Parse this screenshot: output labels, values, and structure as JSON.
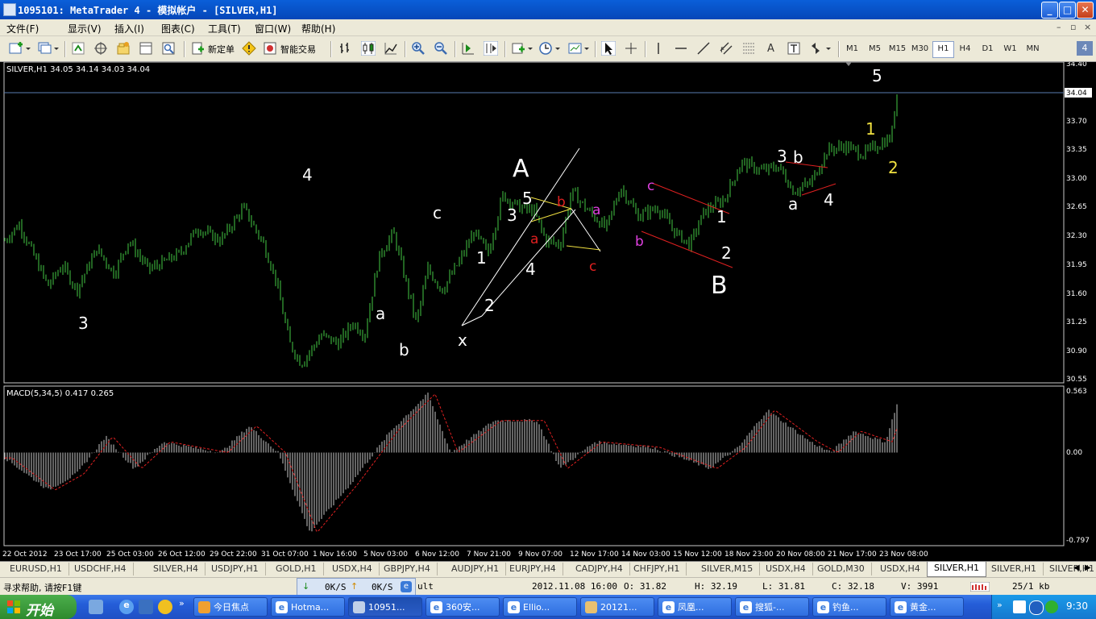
{
  "window": {
    "title": "1095101: MetaTrader 4 - 模拟帐户 - [SILVER,H1]",
    "min": "_",
    "max": "□",
    "close": "✕"
  },
  "menu": {
    "items": [
      "文件(F)",
      "显示(V)",
      "插入(I)",
      "图表(C)",
      "工具(T)",
      "窗口(W)",
      "帮助(H)"
    ],
    "mdi_controls": [
      "–",
      "▫",
      "×"
    ]
  },
  "toolbar": {
    "new_order": "新定单",
    "expert": "智能交易",
    "text_tool": "A",
    "timeframes": [
      "M1",
      "M5",
      "M15",
      "M30",
      "H1",
      "H4",
      "D1",
      "W1",
      "MN"
    ],
    "active_timeframe": "H1",
    "badge": "4"
  },
  "chart": {
    "info": "SILVER,H1  34.05 34.14 34.03 34.04",
    "current_price": "34.04",
    "price_axis": [
      "34.40",
      "34.04",
      "33.70",
      "33.35",
      "33.00",
      "32.65",
      "32.30",
      "31.95",
      "31.60",
      "31.25",
      "30.90",
      "30.55"
    ],
    "macd_info": "MACD(5,34,5) 0.417 0.265",
    "macd_axis": [
      "0.563",
      "0.00",
      "-0.797"
    ],
    "time_axis": [
      "22 Oct 2012",
      "23 Oct 17:00",
      "25 Oct 03:00",
      "26 Oct 12:00",
      "29 Oct 22:00",
      "31 Oct 07:00",
      "1 Nov 16:00",
      "5 Nov 03:00",
      "6 Nov 12:00",
      "7 Nov 21:00",
      "9 Nov 07:00",
      "12 Nov 17:00",
      "14 Nov 03:00",
      "15 Nov 12:00",
      "18 Nov 23:00",
      "20 Nov 08:00",
      "21 Nov 17:00",
      "23 Nov 08:00"
    ],
    "price_line_color": "#5a7bb0",
    "candle_color": "#3aa83a",
    "wave_labels": {
      "w3_left": "3",
      "w4_left": "4",
      "a1": "a",
      "b1": "b",
      "c1": "c",
      "x": "x",
      "i1": "1",
      "i2": "2",
      "i3": "3",
      "i4": "4",
      "i5": "5",
      "A": "A",
      "ra": "a",
      "rb": "b",
      "rc": "c",
      "ma": "a",
      "mb": "b",
      "mc": "c",
      "B": "B",
      "b1w": "1",
      "b2w": "2",
      "t3": "3",
      "tb": "b",
      "ta": "a",
      "t4": "4",
      "y1": "1",
      "y2": "2",
      "t5": "5"
    }
  },
  "chart_data": {
    "type": "candlestick",
    "title": "SILVER,H1",
    "ohlc_last": {
      "open": 34.05,
      "high": 34.14,
      "low": 34.03,
      "close": 34.04
    },
    "x_ticks": [
      "22 Oct 2012",
      "23 Oct 17:00",
      "25 Oct 03:00",
      "26 Oct 12:00",
      "29 Oct 22:00",
      "31 Oct 07:00",
      "1 Nov 16:00",
      "5 Nov 03:00",
      "6 Nov 12:00",
      "7 Nov 21:00",
      "9 Nov 07:00",
      "12 Nov 17:00",
      "14 Nov 03:00",
      "15 Nov 12:00",
      "18 Nov 23:00",
      "20 Nov 08:00",
      "21 Nov 17:00",
      "23 Nov 08:00"
    ],
    "ylim": [
      30.55,
      34.4
    ],
    "close_path": [
      {
        "t": 0,
        "p": 32.25
      },
      {
        "t": 0.5,
        "p": 32.45
      },
      {
        "t": 1.5,
        "p": 31.7
      },
      {
        "t": 2.0,
        "p": 31.95
      },
      {
        "t": 2.5,
        "p": 31.65
      },
      {
        "t": 3.2,
        "p": 32.15
      },
      {
        "t": 3.8,
        "p": 31.85
      },
      {
        "t": 4.3,
        "p": 32.25
      },
      {
        "t": 5.0,
        "p": 31.9
      },
      {
        "t": 5.6,
        "p": 32.0
      },
      {
        "t": 6.1,
        "p": 32.1
      },
      {
        "t": 6.7,
        "p": 32.4
      },
      {
        "t": 7.5,
        "p": 32.25
      },
      {
        "t": 8.3,
        "p": 32.65
      },
      {
        "t": 9.0,
        "p": 32.2
      },
      {
        "t": 9.4,
        "p": 31.8
      },
      {
        "t": 9.9,
        "p": 31.0
      },
      {
        "t": 10.3,
        "p": 30.75
      },
      {
        "t": 11.0,
        "p": 31.1
      },
      {
        "t": 11.6,
        "p": 31.0
      },
      {
        "t": 12.1,
        "p": 31.25
      },
      {
        "t": 12.5,
        "p": 31.1
      },
      {
        "t": 13.0,
        "p": 32.05
      },
      {
        "t": 13.5,
        "p": 32.35
      },
      {
        "t": 13.9,
        "p": 31.8
      },
      {
        "t": 14.3,
        "p": 31.25
      },
      {
        "t": 14.7,
        "p": 31.9
      },
      {
        "t": 15.2,
        "p": 31.65
      },
      {
        "t": 15.8,
        "p": 32.0
      },
      {
        "t": 16.3,
        "p": 32.35
      },
      {
        "t": 16.8,
        "p": 32.1
      },
      {
        "t": 17.3,
        "p": 32.8
      },
      {
        "t": 17.9,
        "p": 32.65
      },
      {
        "t": 18.4,
        "p": 32.6
      },
      {
        "t": 18.8,
        "p": 32.25
      },
      {
        "t": 19.3,
        "p": 32.2
      },
      {
        "t": 19.7,
        "p": 32.85
      },
      {
        "t": 20.3,
        "p": 32.6
      },
      {
        "t": 20.9,
        "p": 32.4
      },
      {
        "t": 21.4,
        "p": 32.9
      },
      {
        "t": 22.0,
        "p": 32.55
      },
      {
        "t": 22.7,
        "p": 32.65
      },
      {
        "t": 23.3,
        "p": 32.35
      },
      {
        "t": 23.8,
        "p": 32.2
      },
      {
        "t": 24.3,
        "p": 32.6
      },
      {
        "t": 25.0,
        "p": 32.75
      },
      {
        "t": 25.6,
        "p": 33.2
      },
      {
        "t": 26.3,
        "p": 33.1
      },
      {
        "t": 26.9,
        "p": 33.15
      },
      {
        "t": 27.4,
        "p": 32.85
      },
      {
        "t": 28.0,
        "p": 32.95
      },
      {
        "t": 28.6,
        "p": 33.35
      },
      {
        "t": 29.2,
        "p": 33.4
      },
      {
        "t": 29.8,
        "p": 33.3
      },
      {
        "t": 30.3,
        "p": 33.4
      },
      {
        "t": 30.8,
        "p": 33.5
      },
      {
        "t": 31.0,
        "p": 34.04
      }
    ],
    "macd": {
      "name": "MACD(5,34,5)",
      "main": 0.417,
      "signal": 0.265,
      "ylim": [
        -0.797,
        0.563
      ],
      "hist_path": [
        {
          "t": 0,
          "p": -0.05
        },
        {
          "t": 1.5,
          "p": -0.35
        },
        {
          "t": 2.5,
          "p": -0.2
        },
        {
          "t": 3.5,
          "p": 0.15
        },
        {
          "t": 4.5,
          "p": -0.15
        },
        {
          "t": 5.5,
          "p": 0.1
        },
        {
          "t": 7.5,
          "p": 0.0
        },
        {
          "t": 8.5,
          "p": 0.25
        },
        {
          "t": 9.5,
          "p": 0.0
        },
        {
          "t": 10.6,
          "p": -0.75
        },
        {
          "t": 12.0,
          "p": -0.3
        },
        {
          "t": 13.4,
          "p": 0.2
        },
        {
          "t": 14.7,
          "p": 0.55
        },
        {
          "t": 15.5,
          "p": 0.0
        },
        {
          "t": 17.0,
          "p": 0.3
        },
        {
          "t": 18.5,
          "p": 0.3
        },
        {
          "t": 19.3,
          "p": -0.15
        },
        {
          "t": 20.5,
          "p": 0.1
        },
        {
          "t": 22.5,
          "p": 0.05
        },
        {
          "t": 24.5,
          "p": -0.15
        },
        {
          "t": 25.5,
          "p": 0.05
        },
        {
          "t": 26.5,
          "p": 0.4
        },
        {
          "t": 28.0,
          "p": 0.1
        },
        {
          "t": 28.7,
          "p": 0.0
        },
        {
          "t": 29.5,
          "p": 0.2
        },
        {
          "t": 30.6,
          "p": 0.1
        },
        {
          "t": 31.0,
          "p": 0.45
        }
      ]
    }
  },
  "tabs": [
    "EURUSD,H1",
    "USDCHF,H4",
    "SILVER,H4",
    "USDJPY,H1",
    "GOLD,H1",
    "USDX,H4",
    "GBPJPY,H4",
    "AUDJPY,H1",
    "EURJPY,H4",
    "CADJPY,H4",
    "CHFJPY,H1",
    "SILVER,M15",
    "USDX,H4",
    "GOLD,M30",
    "USDX,H4",
    "SILVER,H1",
    "SILVER,H1",
    "SILVER,H1"
  ],
  "active_tab": 15,
  "status": {
    "help": "寻求帮助, 请按F1键",
    "down": "0K/S",
    "up": "0K/S",
    "profile": "ult",
    "datetime": "2012.11.08 16:00",
    "open": "O: 31.82",
    "high": "H: 32.19",
    "low": "L: 31.81",
    "close": "C: 32.18",
    "volume": "V: 3991",
    "traffic": "25/1 kb"
  },
  "taskbar": {
    "start": "开始",
    "quick_more": "»",
    "tasks": [
      "今日焦点",
      "Hotma...",
      "10951...",
      "360安...",
      "Ellio...",
      "20121...",
      "凤凰...",
      "搜狐-...",
      "钓鱼...",
      "黄金..."
    ],
    "active_task": 2,
    "tray_arrow": "»",
    "clock": "9:30"
  }
}
